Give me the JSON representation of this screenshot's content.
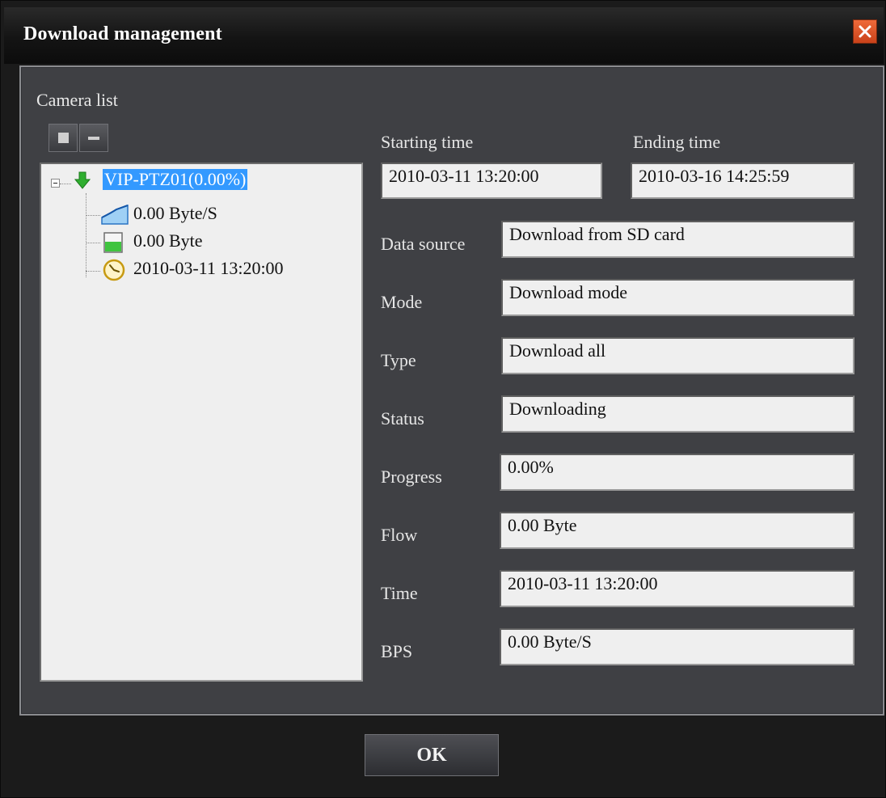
{
  "window": {
    "title": "Download management",
    "close_icon": "close-icon"
  },
  "camera_list": {
    "label": "Camera list",
    "toolbar": {
      "stop_icon": "square-icon",
      "remove_icon": "minus-icon"
    },
    "tree": {
      "root": {
        "label": "VIP-PTZ01(0.00%)",
        "icon": "download-arrow-icon",
        "icon_color": "#2fae2f"
      },
      "children": [
        {
          "label": "0.00 Byte/S",
          "icon": "speed-chart-icon"
        },
        {
          "label": "0.00 Byte",
          "icon": "storage-level-icon"
        },
        {
          "label": "2010-03-11 13:20:00",
          "icon": "clock-icon"
        }
      ]
    }
  },
  "details": {
    "starting_time": {
      "label": "Starting time",
      "value": "2010-03-11 13:20:00"
    },
    "ending_time": {
      "label": "Ending time",
      "value": "2010-03-16 14:25:59"
    },
    "fields": [
      {
        "label": "Data source",
        "value": "Download from SD card"
      },
      {
        "label": "Mode",
        "value": "Download mode"
      },
      {
        "label": "Type",
        "value": "Download all"
      },
      {
        "label": "Status",
        "value": "Downloading"
      },
      {
        "label": "Progress",
        "value": "0.00%"
      },
      {
        "label": "Flow",
        "value": "0.00 Byte"
      },
      {
        "label": "Time",
        "value": "2010-03-11 13:20:00"
      },
      {
        "label": "BPS",
        "value": "0.00 Byte/S"
      }
    ]
  },
  "footer": {
    "ok_label": "OK"
  },
  "colors": {
    "accent_selection": "#3399ff",
    "close_button": "#d9532a",
    "panel_bg": "#3f4044"
  }
}
